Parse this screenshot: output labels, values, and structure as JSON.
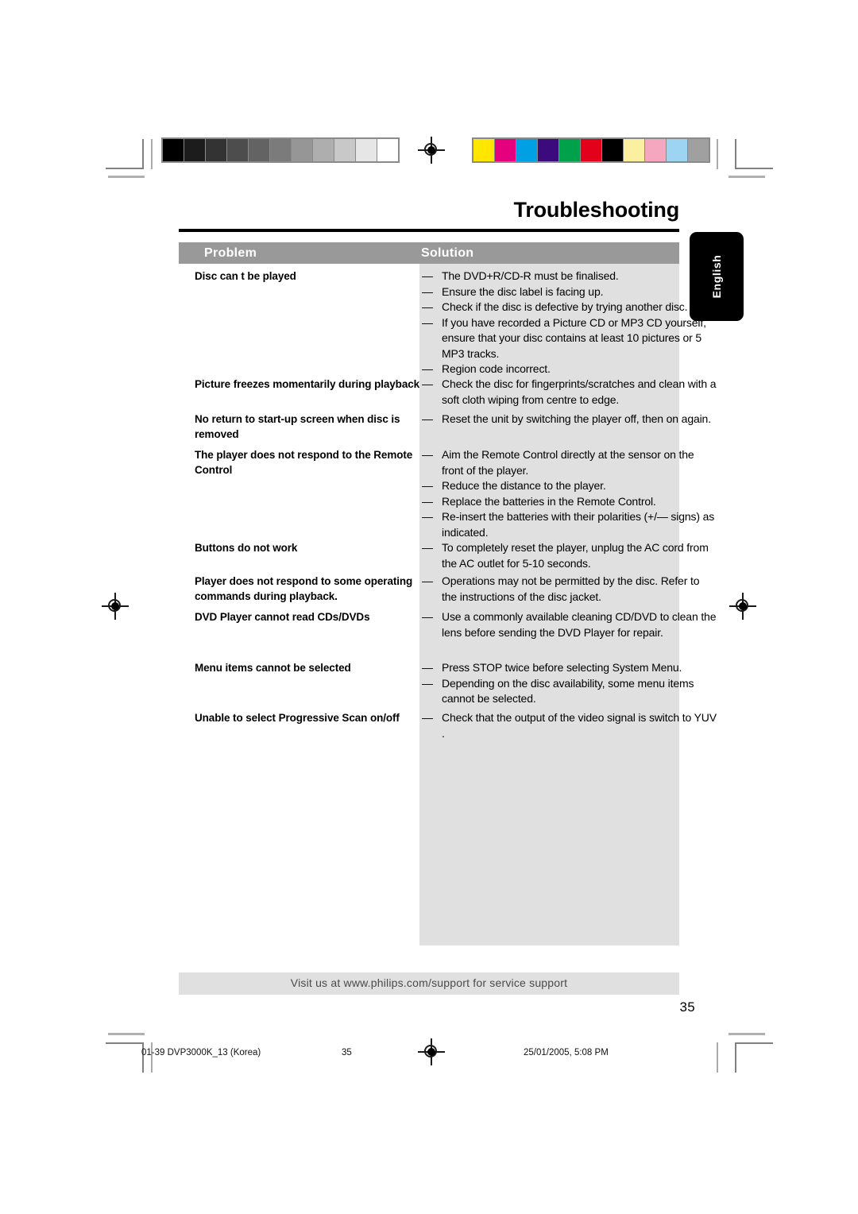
{
  "document": {
    "title": "Troubleshooting",
    "language_tab": "English",
    "page_number": "35"
  },
  "table": {
    "headers": {
      "problem": "Problem",
      "solution": "Solution"
    },
    "rows": [
      {
        "problem": "Disc can t be played",
        "solutions": [
          "The DVD+R/CD-R must be finalised.",
          "Ensure the disc label is facing up.",
          "Check if the disc is defective by trying another disc.",
          "If you have recorded a Picture CD or MP3 CD yourself, ensure that your disc contains at least 10 pictures or 5 MP3 tracks.",
          "Region code incorrect."
        ]
      },
      {
        "problem": "Picture freezes momentarily during playback",
        "solutions": [
          "Check the disc for fingerprints/scratches and clean with a soft cloth wiping from centre to edge."
        ]
      },
      {
        "problem": "No return to start-up screen when disc is removed",
        "solutions": [
          "Reset the unit by switching the player off, then on again."
        ]
      },
      {
        "problem": "The player does not respond to the Remote Control",
        "solutions": [
          "Aim the Remote Control directly at the sensor on the front of the player.",
          "Reduce the distance to the player.",
          "Replace the batteries in the Remote Control.",
          "Re-insert the batteries with their polarities (+/— signs) as indicated."
        ]
      },
      {
        "problem": "Buttons do not work",
        "solutions": [
          "To completely reset the player, unplug the AC cord from the AC outlet for 5-10 seconds."
        ]
      },
      {
        "problem": "Player does not respond to some operating commands during playback.",
        "solutions": [
          "Operations may not be permitted by the disc. Refer to the instructions of  the disc jacket."
        ]
      },
      {
        "problem": "DVD Player cannot read CDs/DVDs",
        "solutions": [
          "Use a commonly available cleaning CD/DVD to clean the lens before sending the DVD Player for repair."
        ]
      },
      {
        "problem": "Menu items cannot be selected",
        "solutions": [
          "Press STOP twice before selecting System Menu.",
          "Depending on the disc availability, some menu items cannot be selected."
        ]
      },
      {
        "problem": "Unable to select Progressive Scan on/off",
        "solutions": [
          "Check that the output of the video signal is switch to YUV ."
        ]
      }
    ]
  },
  "support_bar": {
    "text": "Visit us at www.philips.com/support for service support"
  },
  "print_slug": {
    "file": "01-39 DVP3000K_13 (Korea)",
    "page": "35",
    "date": "25/01/2005, 5:08 PM"
  },
  "calibration": {
    "grayscale": [
      "#000000",
      "#1c1c1c",
      "#333333",
      "#4d4d4d",
      "#636363",
      "#7b7b7b",
      "#969696",
      "#aeaeae",
      "#c8c8c8",
      "#e6e6e6",
      "#ffffff"
    ],
    "colors": [
      "#ffe600",
      "#e5007d",
      "#00a0e4",
      "#3b0a7d",
      "#00a14b",
      "#e2001a",
      "#000000",
      "#faf0a0",
      "#f5a7c0",
      "#9dd4f2",
      "#a0a0a0"
    ]
  },
  "dash": "—"
}
